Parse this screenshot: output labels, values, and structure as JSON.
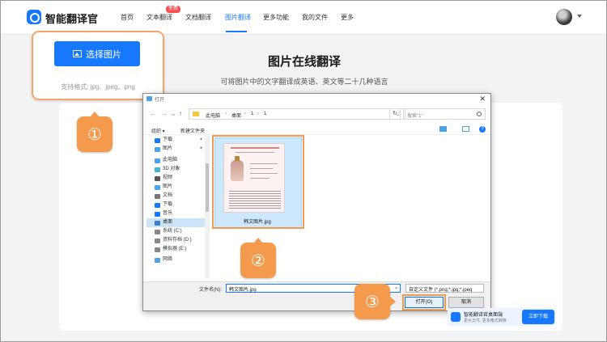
{
  "app": {
    "brand": "智能翻译官"
  },
  "nav": {
    "items": [
      {
        "label": "首页"
      },
      {
        "label": "文本翻译"
      },
      {
        "label": "文档翻译"
      },
      {
        "label": "图片翻译"
      },
      {
        "label": "更多功能"
      },
      {
        "label": "我的文件"
      },
      {
        "label": "更多"
      }
    ],
    "badge": "免费",
    "active": "图片翻译"
  },
  "hero": {
    "title": "图片在线翻译",
    "subtitle": "可将图片中的文字翻译成英语、英文等二十几种语言"
  },
  "upload_card": {
    "button_label": "选择图片",
    "formats": "支持格式: jpg、jpeg、png"
  },
  "markers": {
    "m1": "①",
    "m2": "②",
    "m3": "③"
  },
  "dialog": {
    "title": "打开",
    "close": "✕",
    "path": [
      "此电脑",
      "桌面",
      "1",
      "1"
    ],
    "search_placeholder": "搜索\"1\"",
    "toolbar": {
      "organize": "组织 ▾",
      "new_folder": "新建文件夹"
    },
    "tree": [
      {
        "label": "下载",
        "pinned": true,
        "color": "#1677ff"
      },
      {
        "label": "图片",
        "pinned": true,
        "color": "#4aa3e8"
      },
      {
        "label": "此电脑",
        "pinned": false,
        "color": "#4aa3e8"
      },
      {
        "label": "3D 对象",
        "pinned": false,
        "color": "#3fb3d8"
      },
      {
        "label": "视频",
        "pinned": false,
        "color": "#555555"
      },
      {
        "label": "图片",
        "pinned": false,
        "color": "#4aa3e8"
      },
      {
        "label": "文档",
        "pinned": false,
        "color": "#777777"
      },
      {
        "label": "下载",
        "pinned": false,
        "color": "#1677ff"
      },
      {
        "label": "音乐",
        "pinned": false,
        "color": "#1677ff"
      },
      {
        "label": "桌面",
        "pinned": false,
        "color": "#3a7bd5"
      },
      {
        "label": "系统 (C:)",
        "pinned": false,
        "color": "#888888"
      },
      {
        "label": "资料存档 (D:)",
        "pinned": false,
        "color": "#888888"
      },
      {
        "label": "模拟器 (E:)",
        "pinned": false,
        "color": "#888888"
      },
      {
        "label": "网络",
        "pinned": false,
        "color": "#4aa3e8"
      }
    ],
    "selected_tree": "桌面",
    "file": {
      "name": "韩文图片.jpg"
    },
    "filename_label": "文件名(N):",
    "filename_value": "韩文图片.jpg",
    "filetype": "自定义文件 (*.png;*.jpg;*.jpeg",
    "open_label": "打开(O)",
    "cancel_label": "取消"
  },
  "promo": {
    "line1": "智能翻译官桌面端",
    "line2": "更大文件, 更多格式转换",
    "button": "立即下载"
  },
  "colors": {
    "accent": "#1677ff",
    "callout": "#f39a4c"
  }
}
